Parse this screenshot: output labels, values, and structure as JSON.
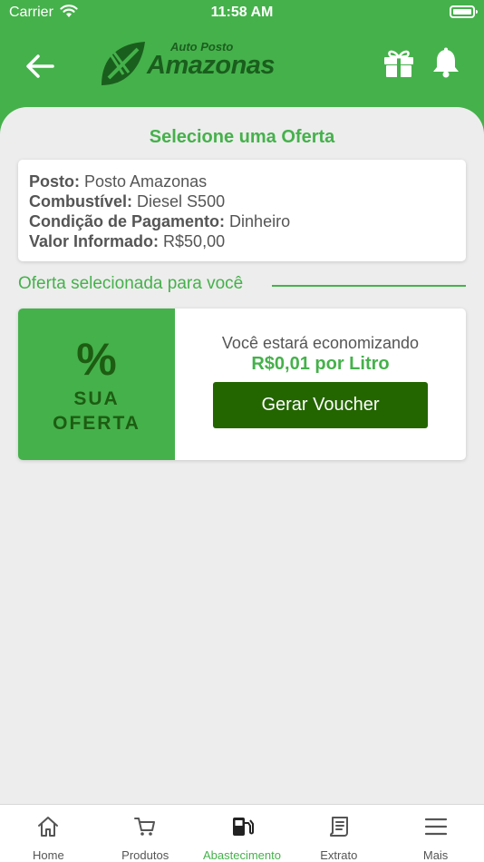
{
  "status_bar": {
    "carrier": "Carrier",
    "time": "11:58 AM"
  },
  "header": {
    "logo_small": "Auto Posto",
    "logo_big": "Amazonas",
    "back_icon": "arrow-left-icon",
    "gift_icon": "gift-icon",
    "bell_icon": "bell-icon",
    "background_color": "#45b14b"
  },
  "page_title": "Selecione uma Oferta",
  "info": {
    "posto_label": "Posto:",
    "posto_value": "Posto Amazonas",
    "combustivel_label": "Combustível:",
    "combustivel_value": "Diesel S500",
    "pagamento_label": "Condição de Pagamento:",
    "pagamento_value": "Dinheiro",
    "valor_label": "Valor Informado:",
    "valor_value": "R$50,00"
  },
  "section_title": "Oferta selecionada para você",
  "offer": {
    "percent_symbol": "%",
    "sua": "SUA",
    "oferta": "OFERTA",
    "saving_text": "Você estará economizando",
    "saving_value": "R$0,01 por Litro",
    "voucher_button": "Gerar Voucher",
    "button_color": "#236600"
  },
  "tabs": [
    {
      "label": "Home",
      "icon": "home-icon",
      "active": false
    },
    {
      "label": "Produtos",
      "icon": "cart-icon",
      "active": false
    },
    {
      "label": "Abastecimento",
      "icon": "fuel-pump-icon",
      "active": true
    },
    {
      "label": "Extrato",
      "icon": "receipt-icon",
      "active": false
    },
    {
      "label": "Mais",
      "icon": "menu-icon",
      "active": false
    }
  ]
}
